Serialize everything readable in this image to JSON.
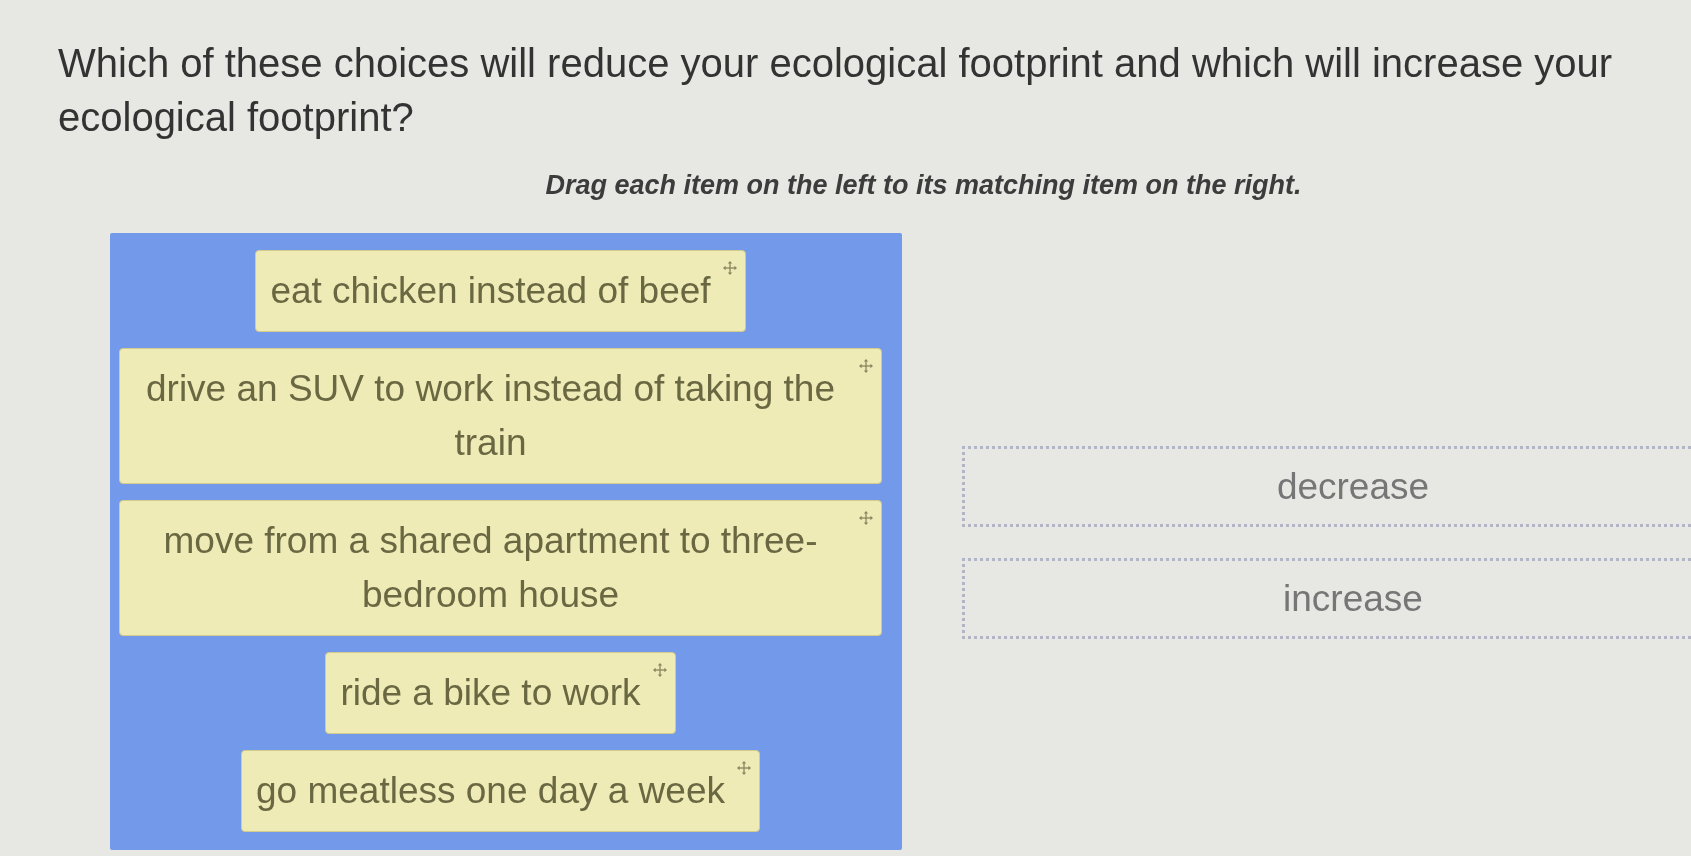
{
  "question": "Which of these choices will reduce your ecological footprint and which will increase your ecological footprint?",
  "instruction": "Drag each item on the left to its matching item on the right.",
  "items": [
    {
      "text": "eat chicken instead of beef"
    },
    {
      "text": "drive an SUV to work instead of taking the train"
    },
    {
      "text": "move from a shared apartment to three-bedroom house"
    },
    {
      "text": "ride a bike to work"
    },
    {
      "text": "go meatless one day a week"
    }
  ],
  "targets": [
    {
      "label": "decrease"
    },
    {
      "label": "increase"
    }
  ]
}
